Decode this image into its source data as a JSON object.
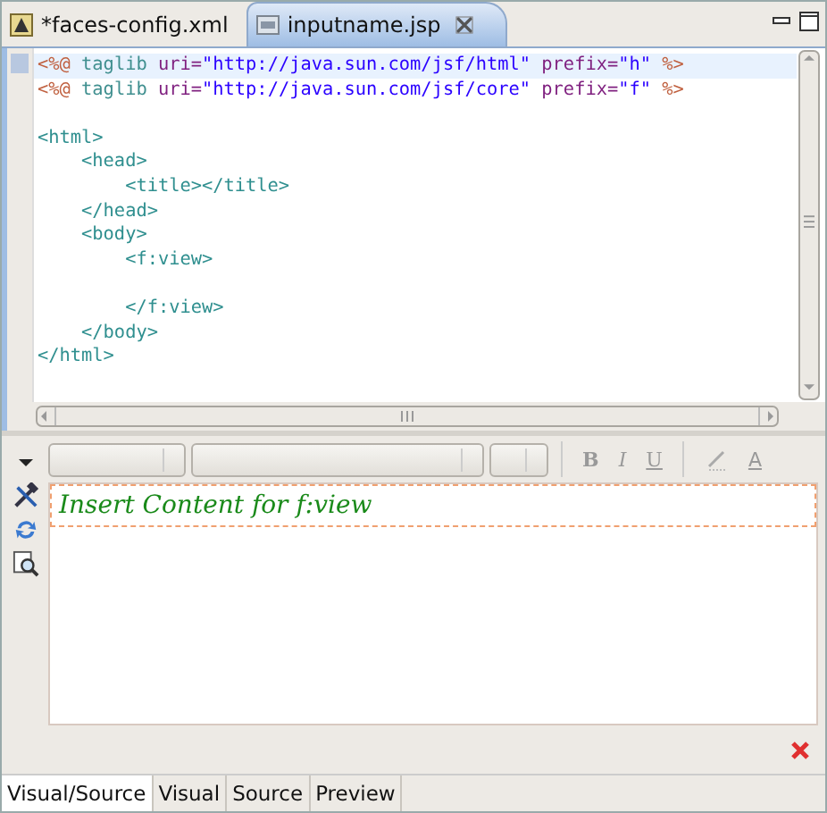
{
  "editor_tabs": [
    {
      "label": "*faces-config.xml",
      "selected": false,
      "closable": false
    },
    {
      "label": "inputname.jsp",
      "selected": true,
      "closable": true
    }
  ],
  "source": {
    "lines": [
      {
        "kind": "code",
        "current": true,
        "tokens": [
          {
            "kind": "directive",
            "text": "<%@"
          },
          {
            "kind": "keyword",
            "text": " taglib"
          },
          {
            "kind": "attr",
            "text": " uri="
          },
          {
            "kind": "string",
            "text": "\"http://java.sun.com/jsf/html\""
          },
          {
            "kind": "attr",
            "text": " prefix="
          },
          {
            "kind": "string",
            "text": "\"h\""
          },
          {
            "kind": "directive",
            "text": " %>"
          }
        ]
      },
      {
        "kind": "code",
        "current": false,
        "tokens": [
          {
            "kind": "directive",
            "text": "<%@"
          },
          {
            "kind": "keyword",
            "text": " taglib"
          },
          {
            "kind": "attr",
            "text": " uri="
          },
          {
            "kind": "string",
            "text": "\"http://java.sun.com/jsf/core\""
          },
          {
            "kind": "attr",
            "text": " prefix="
          },
          {
            "kind": "string",
            "text": "\"f\""
          },
          {
            "kind": "directive",
            "text": " %>"
          }
        ]
      },
      {
        "kind": "blank",
        "current": false
      },
      {
        "kind": "code",
        "current": false,
        "tokens": [
          {
            "kind": "tag",
            "text": "<html>"
          }
        ]
      },
      {
        "kind": "code",
        "current": false,
        "tokens": [
          {
            "kind": "tag",
            "text": "    <head>"
          }
        ]
      },
      {
        "kind": "code",
        "current": false,
        "tokens": [
          {
            "kind": "tag",
            "text": "        <title></title>"
          }
        ]
      },
      {
        "kind": "code",
        "current": false,
        "tokens": [
          {
            "kind": "tag",
            "text": "    </head>"
          }
        ]
      },
      {
        "kind": "code",
        "current": false,
        "tokens": [
          {
            "kind": "tag",
            "text": "    <body>"
          }
        ]
      },
      {
        "kind": "code",
        "current": false,
        "tokens": [
          {
            "kind": "tag",
            "text": "        <f:view>"
          }
        ]
      },
      {
        "kind": "blank",
        "current": false
      },
      {
        "kind": "code",
        "current": false,
        "tokens": [
          {
            "kind": "tag",
            "text": "        </f:view>"
          }
        ]
      },
      {
        "kind": "code",
        "current": false,
        "tokens": [
          {
            "kind": "tag",
            "text": "    </body>"
          }
        ]
      },
      {
        "kind": "code",
        "current": false,
        "tokens": [
          {
            "kind": "tag",
            "text": "</html>"
          }
        ]
      }
    ]
  },
  "toolbar": {
    "format_buttons": [
      {
        "kind": "bold",
        "label": "B"
      },
      {
        "kind": "italic",
        "label": "I"
      },
      {
        "kind": "underline",
        "label": "U"
      }
    ],
    "color_buttons": [
      {
        "kind": "highlight"
      },
      {
        "kind": "font-color",
        "label": "A"
      }
    ]
  },
  "visual": {
    "content_prompt": "Insert Content for f:view"
  },
  "bottom_tabs": [
    {
      "label": "Visual/Source",
      "selected": true
    },
    {
      "label": "Visual",
      "selected": false
    },
    {
      "label": "Source",
      "selected": false
    },
    {
      "label": "Preview",
      "selected": false
    }
  ]
}
